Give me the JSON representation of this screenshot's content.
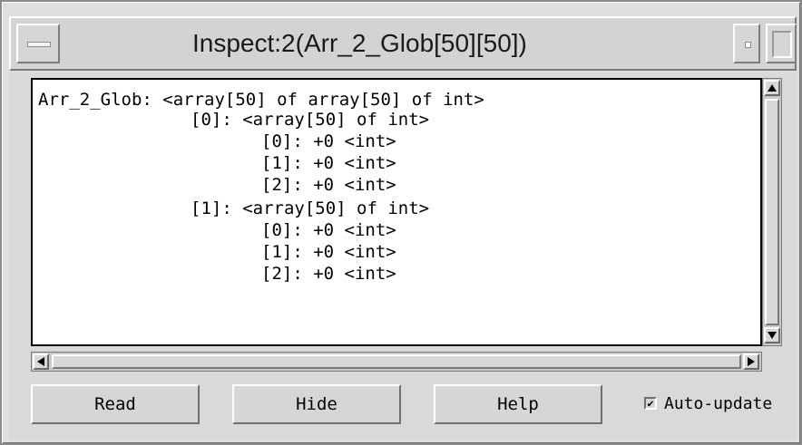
{
  "window": {
    "title": "Inspect:2(Arr_2_Glob[50][50])"
  },
  "inspector": {
    "lines": [
      "Arr_2_Glob: <array[50] of array[50] of int>",
      "[0]: <array[50] of int>",
      "[0]: +0 <int>",
      "[1]: +0 <int>",
      "[2]: +0 <int>",
      "[1]: <array[50] of int>",
      "[0]: +0 <int>",
      "[1]: +0 <int>",
      "[2]: +0 <int>"
    ]
  },
  "buttons": {
    "read": "Read",
    "hide": "Hide",
    "help": "Help"
  },
  "auto_update": {
    "label": "Auto-update",
    "checked": true
  }
}
